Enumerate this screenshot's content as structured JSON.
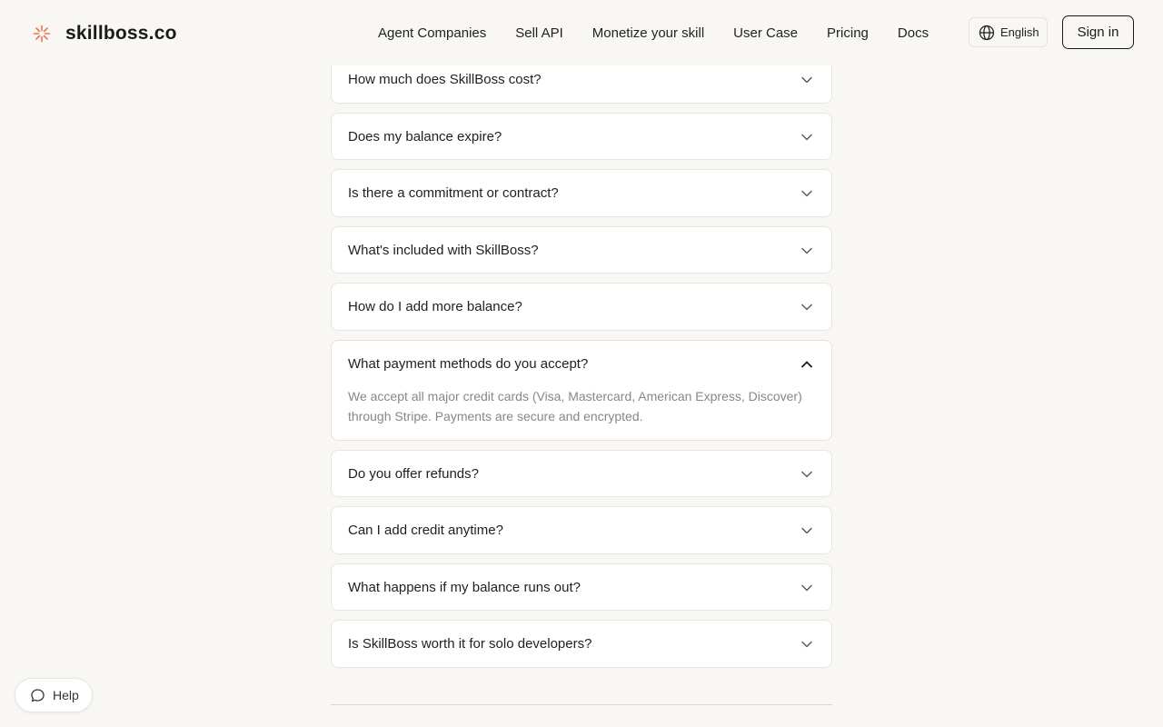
{
  "header": {
    "brand": "skillboss.co",
    "logo_icon": "sunburst-logo-icon",
    "nav": [
      "Agent Companies",
      "Sell API",
      "Monetize your skill",
      "User Case",
      "Pricing",
      "Docs"
    ],
    "language": "English",
    "language_icon": "globe-icon",
    "signin": "Sign in"
  },
  "faq": {
    "items": [
      {
        "q": "How much does SkillBoss cost?"
      },
      {
        "q": "Does my balance expire?"
      },
      {
        "q": "Is there a commitment or contract?"
      },
      {
        "q": "What's included with SkillBoss?"
      },
      {
        "q": "How do I add more balance?"
      },
      {
        "q": "What payment methods do you accept?",
        "a": "We accept all major credit cards (Visa, Mastercard, American Express, Discover) through Stripe. Payments are secure and encrypted.",
        "expanded": true
      },
      {
        "q": "Do you offer refunds?"
      },
      {
        "q": "Can I add credit anytime?"
      },
      {
        "q": "What happens if my balance runs out?"
      },
      {
        "q": "Is SkillBoss worth it for solo developers?"
      }
    ]
  },
  "help": {
    "label": "Help",
    "icon": "chat-bubble-icon"
  },
  "colors": {
    "background": "#f8f7f4",
    "accent": "#e8745a",
    "answer_text": "#8a8782"
  }
}
